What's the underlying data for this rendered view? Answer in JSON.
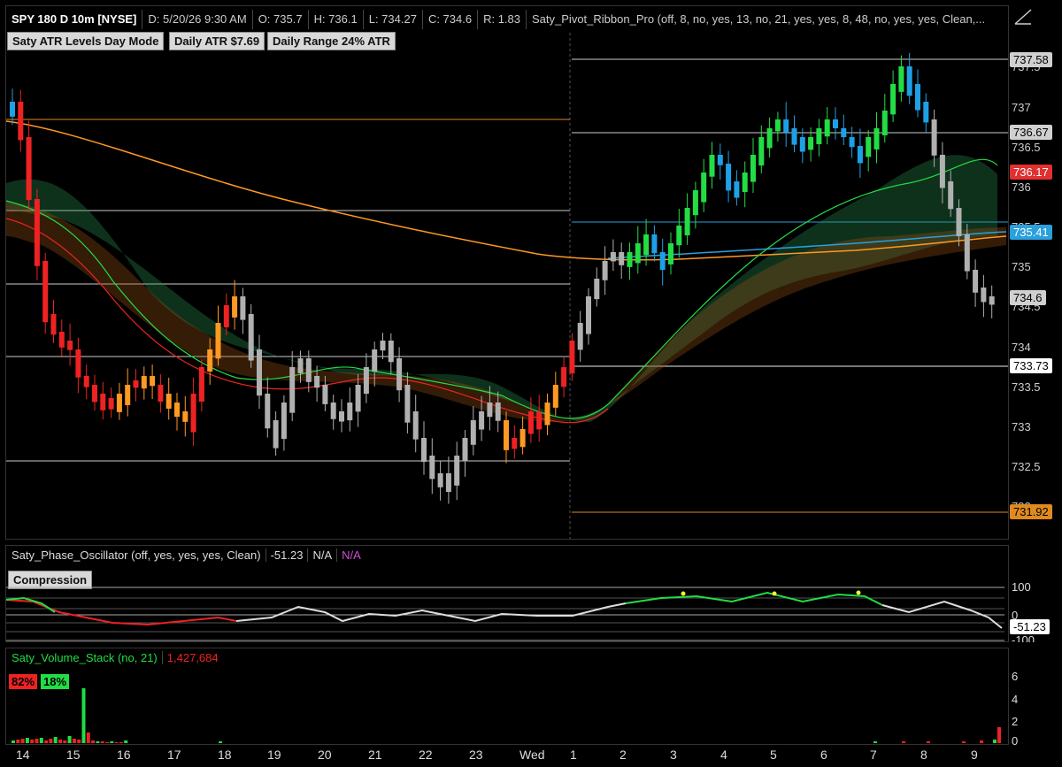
{
  "header": {
    "symbol": "SPY 180 D 10m [NYSE]",
    "date": "D: 5/20/26 9:30 AM",
    "open": "O: 735.7",
    "high": "H: 736.1",
    "low": "L: 734.27",
    "close": "C: 734.6",
    "range": "R: 1.83",
    "study": "Saty_Pivot_Ribbon_Pro (off, 8, no, yes, 13, no, 21, yes, yes, 8, 48, no, yes, yes, Clean,..."
  },
  "chips": {
    "mode": "Saty ATR Levels Day Mode",
    "atr": "Daily ATR $7.69",
    "range": "Daily Range 24% ATR"
  },
  "price_axis": [
    "737.5",
    "737",
    "736.5",
    "736",
    "735.5",
    "735",
    "734.5",
    "734",
    "733.5",
    "733",
    "732.5",
    "732"
  ],
  "price_tags": {
    "t1": "737.58",
    "t2": "736.67",
    "t3": "736.17",
    "t4": "735.41",
    "t5": "734.6",
    "t6": "733.73",
    "t7": "731.92"
  },
  "colors": {
    "up_green": "#22dd44",
    "up_blue": "#1ea0e6",
    "down_red": "#ee2222",
    "orange": "#ff9922",
    "gray": "#b0b0b0",
    "level_orange": "#e08a1e",
    "level_blue": "#2aa0dd",
    "level_white": "#cccccc"
  },
  "oscillator": {
    "name": "Saty_Phase_Oscillator (off, yes, yes, yes, Clean)",
    "value": "-51.23",
    "na1": "N/A",
    "na2": "N/A",
    "badge": "Compression",
    "axis": [
      "100",
      "0",
      "-100"
    ],
    "tag": "-51.23"
  },
  "volume": {
    "name": "Saty_Volume_Stack (no, 21)",
    "value": "1,427,684",
    "sell_pct": "82%",
    "buy_pct": "18%",
    "axis": [
      "6",
      "4",
      "2",
      "0"
    ]
  },
  "x_axis": [
    "14",
    "15",
    "16",
    "17",
    "18",
    "19",
    "20",
    "21",
    "22",
    "23",
    "Wed",
    "1",
    "2",
    "3",
    "4",
    "5",
    "6",
    "7",
    "8",
    "9"
  ],
  "icons": {
    "draw_tool": "drawing-tool-icon"
  }
}
